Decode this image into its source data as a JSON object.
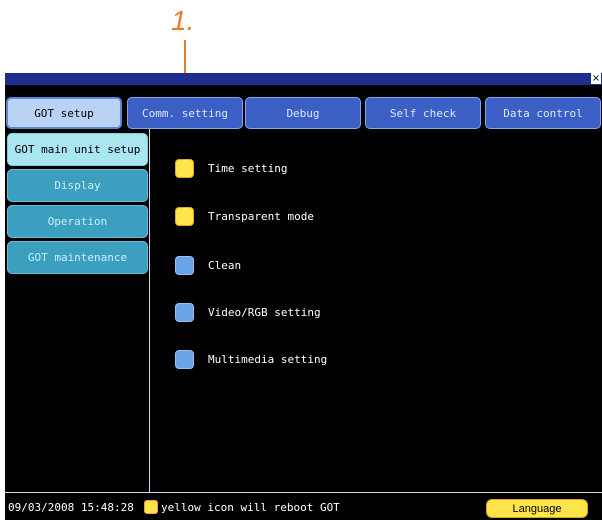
{
  "annotation": {
    "callout_number": "1."
  },
  "window": {
    "close_glyph": "×"
  },
  "tabs": [
    {
      "label": "GOT setup",
      "active": true
    },
    {
      "label": "Comm. setting",
      "active": false
    },
    {
      "label": "Debug",
      "active": false
    },
    {
      "label": "Self check",
      "active": false
    },
    {
      "label": "Data control",
      "active": false
    }
  ],
  "sidebar": {
    "items": [
      {
        "label": "GOT main unit setup",
        "active": true
      },
      {
        "label": "Display",
        "active": false
      },
      {
        "label": "Operation",
        "active": false
      },
      {
        "label": "GOT maintenance",
        "active": false
      }
    ]
  },
  "main": {
    "items": [
      {
        "label": "Time setting",
        "icon": "yellow"
      },
      {
        "label": "Transparent mode",
        "icon": "yellow"
      },
      {
        "label": "Clean",
        "icon": "blue"
      },
      {
        "label": "Video/RGB setting",
        "icon": "blue"
      },
      {
        "label": "Multimedia setting",
        "icon": "blue"
      }
    ]
  },
  "status": {
    "datetime": "09/03/2008 15:48:28",
    "legend_text": "yellow icon will reboot GOT",
    "language_label": "Language"
  },
  "colors": {
    "accent_orange": "#e87c2a",
    "titlebar": "#1e2e8c",
    "tab_blue": "#3b5fc4",
    "tab_active": "#bad3f5",
    "sidebar_teal": "#3d9fbf",
    "sidebar_active": "#a9e6ef",
    "icon_yellow": "#ffe44a",
    "icon_blue": "#6ba4e6"
  }
}
